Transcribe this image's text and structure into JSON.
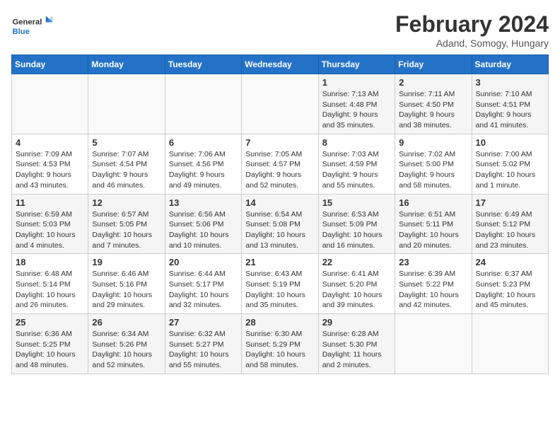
{
  "logo": {
    "line1": "General",
    "line2": "Blue"
  },
  "title": "February 2024",
  "subtitle": "Adand, Somogy, Hungary",
  "weekdays": [
    "Sunday",
    "Monday",
    "Tuesday",
    "Wednesday",
    "Thursday",
    "Friday",
    "Saturday"
  ],
  "weeks": [
    [
      {
        "day": "",
        "info": ""
      },
      {
        "day": "",
        "info": ""
      },
      {
        "day": "",
        "info": ""
      },
      {
        "day": "",
        "info": ""
      },
      {
        "day": "1",
        "info": "Sunrise: 7:13 AM\nSunset: 4:48 PM\nDaylight: 9 hours\nand 35 minutes."
      },
      {
        "day": "2",
        "info": "Sunrise: 7:11 AM\nSunset: 4:50 PM\nDaylight: 9 hours\nand 38 minutes."
      },
      {
        "day": "3",
        "info": "Sunrise: 7:10 AM\nSunset: 4:51 PM\nDaylight: 9 hours\nand 41 minutes."
      }
    ],
    [
      {
        "day": "4",
        "info": "Sunrise: 7:09 AM\nSunset: 4:53 PM\nDaylight: 9 hours\nand 43 minutes."
      },
      {
        "day": "5",
        "info": "Sunrise: 7:07 AM\nSunset: 4:54 PM\nDaylight: 9 hours\nand 46 minutes."
      },
      {
        "day": "6",
        "info": "Sunrise: 7:06 AM\nSunset: 4:56 PM\nDaylight: 9 hours\nand 49 minutes."
      },
      {
        "day": "7",
        "info": "Sunrise: 7:05 AM\nSunset: 4:57 PM\nDaylight: 9 hours\nand 52 minutes."
      },
      {
        "day": "8",
        "info": "Sunrise: 7:03 AM\nSunset: 4:59 PM\nDaylight: 9 hours\nand 55 minutes."
      },
      {
        "day": "9",
        "info": "Sunrise: 7:02 AM\nSunset: 5:00 PM\nDaylight: 9 hours\nand 58 minutes."
      },
      {
        "day": "10",
        "info": "Sunrise: 7:00 AM\nSunset: 5:02 PM\nDaylight: 10 hours\nand 1 minute."
      }
    ],
    [
      {
        "day": "11",
        "info": "Sunrise: 6:59 AM\nSunset: 5:03 PM\nDaylight: 10 hours\nand 4 minutes."
      },
      {
        "day": "12",
        "info": "Sunrise: 6:57 AM\nSunset: 5:05 PM\nDaylight: 10 hours\nand 7 minutes."
      },
      {
        "day": "13",
        "info": "Sunrise: 6:56 AM\nSunset: 5:06 PM\nDaylight: 10 hours\nand 10 minutes."
      },
      {
        "day": "14",
        "info": "Sunrise: 6:54 AM\nSunset: 5:08 PM\nDaylight: 10 hours\nand 13 minutes."
      },
      {
        "day": "15",
        "info": "Sunrise: 6:53 AM\nSunset: 5:09 PM\nDaylight: 10 hours\nand 16 minutes."
      },
      {
        "day": "16",
        "info": "Sunrise: 6:51 AM\nSunset: 5:11 PM\nDaylight: 10 hours\nand 20 minutes."
      },
      {
        "day": "17",
        "info": "Sunrise: 6:49 AM\nSunset: 5:12 PM\nDaylight: 10 hours\nand 23 minutes."
      }
    ],
    [
      {
        "day": "18",
        "info": "Sunrise: 6:48 AM\nSunset: 5:14 PM\nDaylight: 10 hours\nand 26 minutes."
      },
      {
        "day": "19",
        "info": "Sunrise: 6:46 AM\nSunset: 5:16 PM\nDaylight: 10 hours\nand 29 minutes."
      },
      {
        "day": "20",
        "info": "Sunrise: 6:44 AM\nSunset: 5:17 PM\nDaylight: 10 hours\nand 32 minutes."
      },
      {
        "day": "21",
        "info": "Sunrise: 6:43 AM\nSunset: 5:19 PM\nDaylight: 10 hours\nand 35 minutes."
      },
      {
        "day": "22",
        "info": "Sunrise: 6:41 AM\nSunset: 5:20 PM\nDaylight: 10 hours\nand 39 minutes."
      },
      {
        "day": "23",
        "info": "Sunrise: 6:39 AM\nSunset: 5:22 PM\nDaylight: 10 hours\nand 42 minutes."
      },
      {
        "day": "24",
        "info": "Sunrise: 6:37 AM\nSunset: 5:23 PM\nDaylight: 10 hours\nand 45 minutes."
      }
    ],
    [
      {
        "day": "25",
        "info": "Sunrise: 6:36 AM\nSunset: 5:25 PM\nDaylight: 10 hours\nand 48 minutes."
      },
      {
        "day": "26",
        "info": "Sunrise: 6:34 AM\nSunset: 5:26 PM\nDaylight: 10 hours\nand 52 minutes."
      },
      {
        "day": "27",
        "info": "Sunrise: 6:32 AM\nSunset: 5:27 PM\nDaylight: 10 hours\nand 55 minutes."
      },
      {
        "day": "28",
        "info": "Sunrise: 6:30 AM\nSunset: 5:29 PM\nDaylight: 10 hours\nand 58 minutes."
      },
      {
        "day": "29",
        "info": "Sunrise: 6:28 AM\nSunset: 5:30 PM\nDaylight: 11 hours\nand 2 minutes."
      },
      {
        "day": "",
        "info": ""
      },
      {
        "day": "",
        "info": ""
      }
    ]
  ]
}
